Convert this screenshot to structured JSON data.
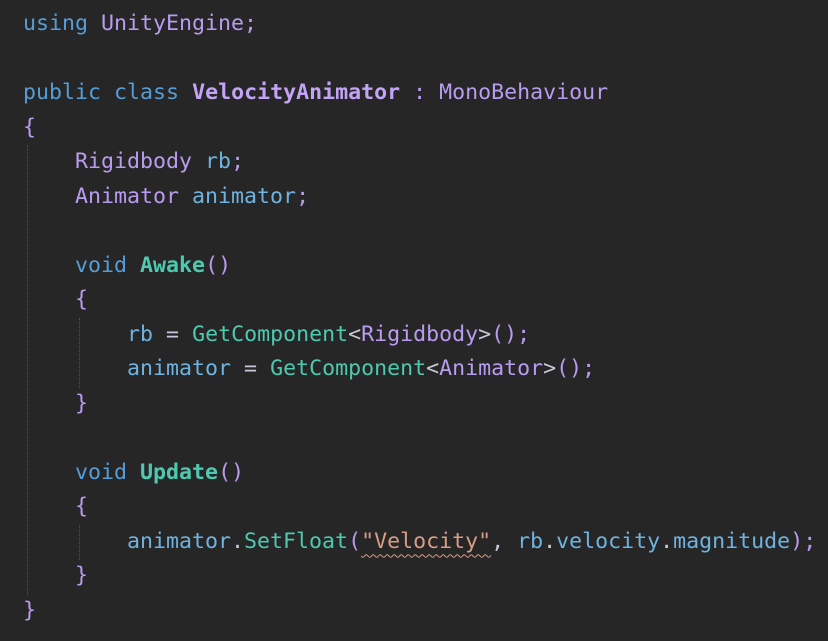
{
  "colors": {
    "background": "#262626",
    "keyword": "#569cd6",
    "class_name": "#c2a3f5",
    "type": "#b99cf0",
    "identifier": "#6fb3e0",
    "method": "#4ec9b0",
    "string": "#d69d85"
  },
  "code_lines": [
    [
      {
        "t": "using",
        "c": "kw"
      },
      {
        "t": " "
      },
      {
        "t": "UnityEngine",
        "c": "type"
      },
      {
        "t": ";",
        "c": "p"
      }
    ],
    [],
    [
      {
        "t": "public",
        "c": "kw"
      },
      {
        "t": " "
      },
      {
        "t": "class",
        "c": "kw"
      },
      {
        "t": " "
      },
      {
        "t": "VelocityAnimator",
        "c": "cls"
      },
      {
        "t": " "
      },
      {
        "t": ":",
        "c": "p"
      },
      {
        "t": " "
      },
      {
        "t": "MonoBehaviour",
        "c": "type"
      }
    ],
    [
      {
        "t": "{",
        "c": "p"
      }
    ],
    [
      {
        "t": "    "
      },
      {
        "t": "Rigidbody",
        "c": "type"
      },
      {
        "t": " "
      },
      {
        "t": "rb",
        "c": "id"
      },
      {
        "t": ";",
        "c": "p"
      }
    ],
    [
      {
        "t": "    "
      },
      {
        "t": "Animator",
        "c": "type"
      },
      {
        "t": " "
      },
      {
        "t": "animator",
        "c": "id"
      },
      {
        "t": ";",
        "c": "p"
      }
    ],
    [],
    [
      {
        "t": "    "
      },
      {
        "t": "void",
        "c": "kw"
      },
      {
        "t": " "
      },
      {
        "t": "Awake",
        "c": "fnb"
      },
      {
        "t": "()",
        "c": "p"
      }
    ],
    [
      {
        "t": "    "
      },
      {
        "t": "{",
        "c": "p"
      }
    ],
    [
      {
        "t": "        "
      },
      {
        "t": "rb",
        "c": "id"
      },
      {
        "t": " "
      },
      {
        "t": "=",
        "c": "op"
      },
      {
        "t": " "
      },
      {
        "t": "GetComponent",
        "c": "fn"
      },
      {
        "t": "<",
        "c": "op"
      },
      {
        "t": "Rigidbody",
        "c": "type"
      },
      {
        "t": ">",
        "c": "op"
      },
      {
        "t": "();",
        "c": "p"
      }
    ],
    [
      {
        "t": "        "
      },
      {
        "t": "animator",
        "c": "id"
      },
      {
        "t": " "
      },
      {
        "t": "=",
        "c": "op"
      },
      {
        "t": " "
      },
      {
        "t": "GetComponent",
        "c": "fn"
      },
      {
        "t": "<",
        "c": "op"
      },
      {
        "t": "Animator",
        "c": "type"
      },
      {
        "t": ">",
        "c": "op"
      },
      {
        "t": "();",
        "c": "p"
      }
    ],
    [
      {
        "t": "    "
      },
      {
        "t": "}",
        "c": "p"
      }
    ],
    [],
    [
      {
        "t": "    "
      },
      {
        "t": "void",
        "c": "kw"
      },
      {
        "t": " "
      },
      {
        "t": "Update",
        "c": "fnb"
      },
      {
        "t": "()",
        "c": "p"
      }
    ],
    [
      {
        "t": "    "
      },
      {
        "t": "{",
        "c": "p"
      }
    ],
    [
      {
        "t": "        "
      },
      {
        "t": "animator",
        "c": "id"
      },
      {
        "t": ".",
        "c": "op"
      },
      {
        "t": "SetFloat",
        "c": "fn"
      },
      {
        "t": "(",
        "c": "p"
      },
      {
        "t": "\"Velocity\"",
        "c": "str squig"
      },
      {
        "t": ", ",
        "c": "op"
      },
      {
        "t": "rb",
        "c": "id"
      },
      {
        "t": ".",
        "c": "op"
      },
      {
        "t": "velocity",
        "c": "id"
      },
      {
        "t": ".",
        "c": "op"
      },
      {
        "t": "magnitude",
        "c": "id"
      },
      {
        "t": ");",
        "c": "p"
      }
    ],
    [
      {
        "t": "    "
      },
      {
        "t": "}",
        "c": "p"
      }
    ],
    [
      {
        "t": "}",
        "c": "p"
      }
    ]
  ]
}
